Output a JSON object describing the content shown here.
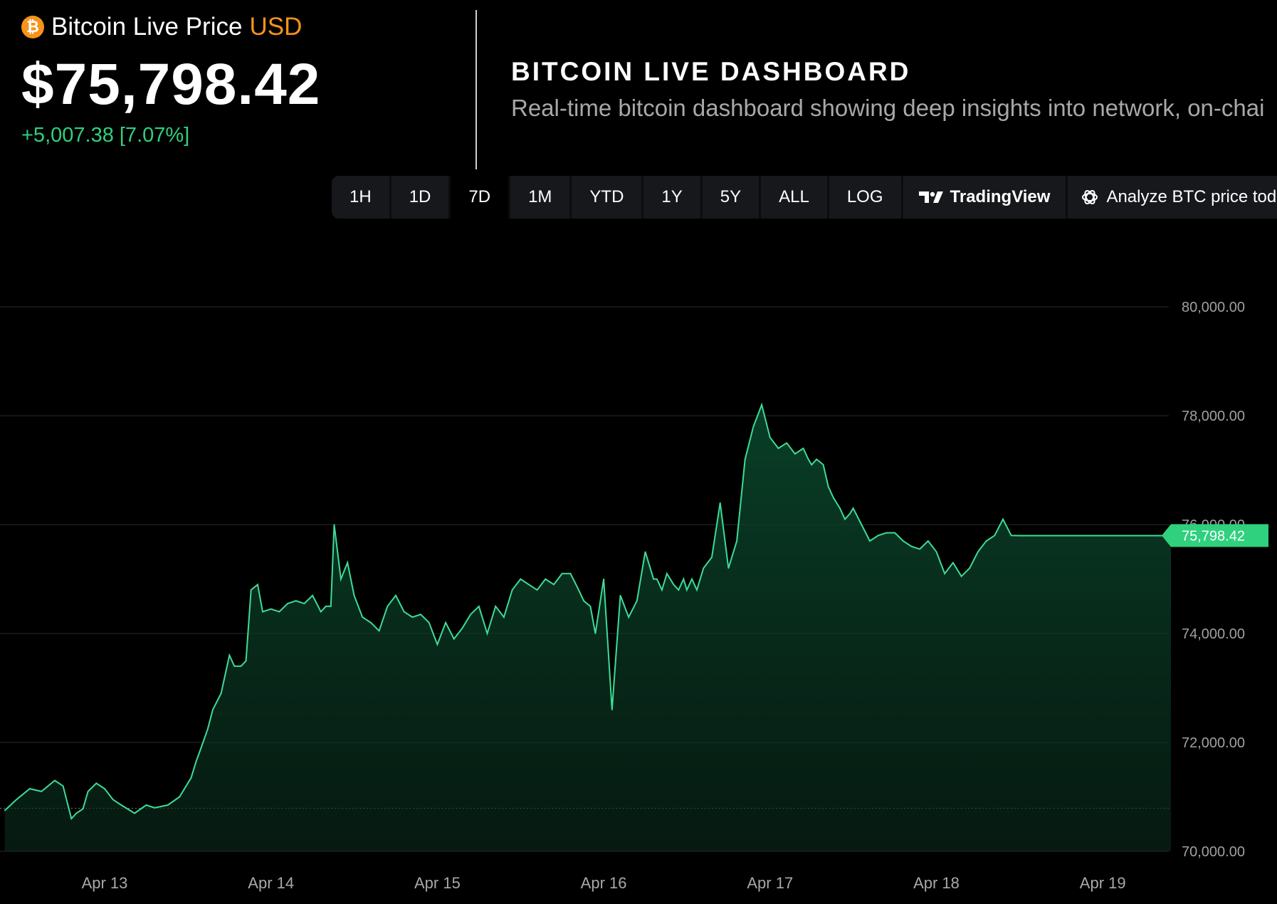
{
  "header": {
    "icon": "bitcoin-icon",
    "title": "Bitcoin Live Price",
    "currency": "USD",
    "price": "$75,798.42",
    "change": "+5,007.38 [7.07%]"
  },
  "dashboard": {
    "title": "BITCOIN LIVE DASHBOARD",
    "subtitle": "Real-time bitcoin dashboard showing deep insights into network, on-chai"
  },
  "toolbar": {
    "ranges": [
      "1H",
      "1D",
      "7D",
      "1M",
      "YTD",
      "1Y",
      "5Y",
      "ALL",
      "LOG"
    ],
    "active_range": "7D",
    "tradingview_label": "TradingView",
    "tradingview_icon": "tradingview-logo-icon",
    "analyze_label": "Analyze BTC price today",
    "analyze_icon": "openai-icon"
  },
  "colors": {
    "accent_up": "#2fd07e",
    "accent_down": "#e0323b",
    "currency": "#f7931a",
    "line": "#3ddc97"
  },
  "chart_data": {
    "type": "area",
    "x_tick_labels": [
      "Apr 13",
      "Apr 14",
      "Apr 15",
      "Apr 16",
      "Apr 17",
      "Apr 18",
      "Apr 19"
    ],
    "y_tick_labels": [
      "80,000.00",
      "78,000.00",
      "76,000.00",
      "74,000.00",
      "72,000.00",
      "70,000.00"
    ],
    "ylim": [
      70000,
      80000
    ],
    "baseline": 70791,
    "current_label": "75,798.42",
    "current_value": 75798.42,
    "grid": true,
    "series": [
      {
        "x_days": [
          12.4,
          12.47,
          12.55,
          12.62,
          12.7,
          12.75,
          12.8,
          12.83,
          12.87,
          12.9,
          12.95,
          13.0,
          13.05,
          13.1,
          13.18,
          13.25,
          13.3,
          13.38,
          13.45,
          13.52,
          13.55,
          13.58,
          13.62,
          13.65,
          13.7,
          13.75,
          13.78,
          13.82,
          13.85,
          13.88,
          13.92,
          13.95,
          14.0,
          14.05,
          14.1,
          14.15,
          14.2,
          14.25,
          14.3,
          14.33,
          14.36,
          14.38,
          14.42,
          14.46,
          14.5,
          14.55,
          14.6,
          14.65,
          14.7,
          14.75,
          14.8,
          14.85,
          14.9,
          14.95,
          15.0,
          15.05,
          15.1,
          15.15,
          15.2,
          15.25,
          15.3,
          15.35,
          15.4,
          15.45,
          15.5,
          15.55,
          15.6,
          15.65,
          15.7,
          15.75,
          15.8,
          15.85,
          15.88,
          15.92,
          15.95,
          16.0,
          16.05,
          16.1,
          16.15,
          16.2,
          16.25,
          16.3,
          16.32,
          16.35,
          16.38,
          16.42,
          16.45,
          16.48,
          16.5,
          16.53,
          16.56,
          16.6,
          16.65,
          16.7,
          16.75,
          16.8,
          16.85,
          16.9,
          16.95,
          17.0,
          17.05,
          17.1,
          17.15,
          17.2,
          17.23,
          17.25,
          17.28,
          17.32,
          17.35,
          17.38,
          17.42,
          17.45,
          17.48,
          17.5,
          17.55,
          17.6,
          17.65,
          17.7,
          17.75,
          17.8,
          17.85,
          17.9,
          17.95,
          18.0,
          18.05,
          18.1,
          18.15,
          18.2,
          18.25,
          18.3,
          18.35,
          18.4,
          18.45,
          18.5,
          18.55,
          18.6,
          18.65,
          18.7,
          18.75,
          18.8,
          18.85,
          18.9,
          18.95,
          19.0,
          19.05,
          19.1,
          19.15,
          19.2,
          19.25,
          19.3,
          19.35,
          19.38,
          19.41
        ],
        "values": [
          70750,
          70950,
          71150,
          71100,
          71300,
          71200,
          70600,
          70700,
          70780,
          71100,
          71250,
          71150,
          70950,
          70850,
          70700,
          70850,
          70800,
          70850,
          71000,
          71350,
          71650,
          71900,
          72250,
          72600,
          72900,
          73600,
          73400,
          73400,
          73500,
          74800,
          74900,
          74400,
          74450,
          74400,
          74550,
          74600,
          74550,
          74700,
          74400,
          74500,
          74500,
          76000,
          75000,
          75300,
          74700,
          74300,
          74200,
          74050,
          74500,
          74700,
          74400,
          74300,
          74350,
          74200,
          73800,
          74200,
          73900,
          74100,
          74350,
          74500,
          74000,
          74500,
          74300,
          74800,
          75000,
          74900,
          74800,
          75000,
          74900,
          75100,
          75100,
          74800,
          74600,
          74500,
          74000,
          75000,
          72600,
          74700,
          74300,
          74600,
          75500,
          75000,
          75000,
          74800,
          75100,
          74900,
          74800,
          75000,
          74800,
          75000,
          74800,
          75200,
          75400,
          76400,
          75200,
          75700,
          77200,
          77800,
          78200,
          77600,
          77400,
          77500,
          77300,
          77400,
          77200,
          77100,
          77200,
          77100,
          76700,
          76500,
          76300,
          76100,
          76200,
          76300,
          76000,
          75700,
          75800,
          75850,
          75850,
          75700,
          75600,
          75550,
          75700,
          75500,
          75100,
          75300,
          75050,
          75200,
          75500,
          75700,
          75800,
          76100,
          75800,
          75798,
          75798,
          75798,
          75798,
          75798,
          75798,
          75798,
          75798,
          75798,
          75798,
          75798,
          75798,
          75798,
          75798,
          75798,
          75798,
          75798,
          75798,
          75798,
          75798,
          75798,
          75798
        ]
      }
    ]
  }
}
